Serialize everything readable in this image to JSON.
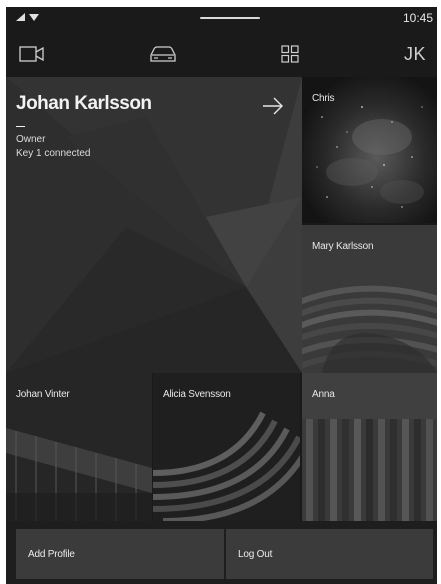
{
  "status_bar": {
    "time": "10:45",
    "icons": [
      "signal-icon",
      "wifi-icon"
    ]
  },
  "top_nav": {
    "items": [
      {
        "name": "camera",
        "icon": "camera-icon"
      },
      {
        "name": "car",
        "icon": "car-icon"
      },
      {
        "name": "apps",
        "icon": "app-grid-icon"
      }
    ],
    "initials": "JK"
  },
  "current_profile": {
    "name": "Johan Karlsson",
    "role": "Owner",
    "key_status": "Key 1 connected",
    "arrow_icon": "arrow-right-icon"
  },
  "profiles": [
    {
      "name": "Chris"
    },
    {
      "name": "Mary Karlsson"
    },
    {
      "name": "Johan Vinter"
    },
    {
      "name": "Alicia Svensson"
    },
    {
      "name": "Anna"
    }
  ],
  "actions": {
    "add_profile": "Add Profile",
    "log_out": "Log Out"
  },
  "colors": {
    "background": "#1a1a1a",
    "tile_dark": "#2c2c2c",
    "button": "#3b3b3b",
    "text": "#e8e8e8"
  }
}
